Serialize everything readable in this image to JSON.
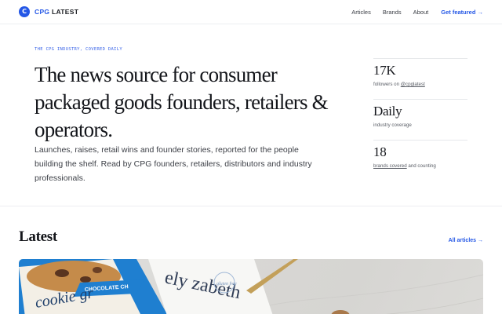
{
  "brand": {
    "mark": "C",
    "name_accent": "CPG",
    "name_rest": " LATEST",
    "accent_color": "#2457e6"
  },
  "nav": {
    "links": [
      "Articles",
      "Brands",
      "About"
    ],
    "cta": "Get featured →"
  },
  "hero": {
    "eyebrow": "THE CPG INDUSTRY, COVERED DAILY",
    "headline": "The news source for consumer packaged goods founders, retailers & operators.",
    "subcopy": "Launches, raises, retail wins and founder stories, reported for the people building the shelf. Read by CPG founders, retailers, distributors and industry professionals."
  },
  "stats": [
    {
      "value": "17K",
      "label_prefix": "followers on ",
      "label_link": "@cpglatest",
      "label_suffix": ""
    },
    {
      "value": "Daily",
      "label_prefix": "industry coverage",
      "label_link": "",
      "label_suffix": ""
    },
    {
      "value": "18",
      "label_prefix": "",
      "label_link": "brands covered",
      "label_suffix": " and counting"
    }
  ],
  "latest": {
    "title": "Latest",
    "all_link": "All articles →",
    "featured_image": {
      "package_brand_text": "ely zabeth",
      "package_product_text": "cookie gr",
      "package_flavor_text": "CHOCOLATE CH",
      "badge_text": "gluten free",
      "package_colors": {
        "blue": "#1f7fd0",
        "cream": "#f3efe6"
      }
    }
  }
}
